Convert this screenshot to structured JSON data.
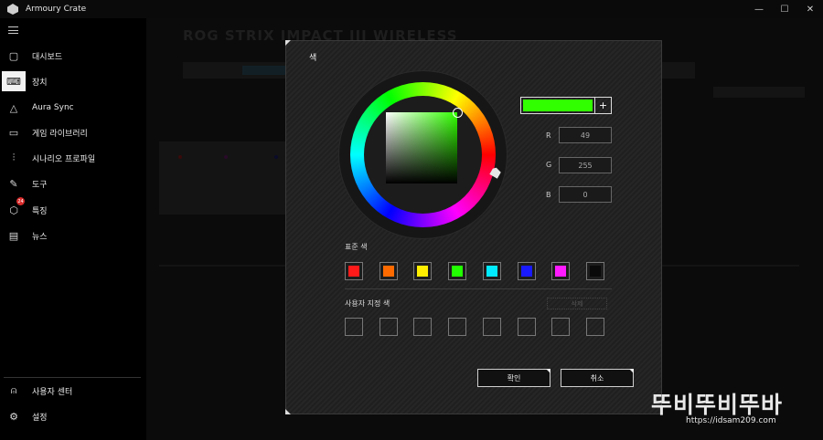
{
  "window": {
    "title": "Armoury Crate",
    "controls": [
      "—",
      "☐",
      "✕"
    ]
  },
  "sidebar": {
    "items": [
      {
        "label": "대시보드",
        "icon": "dashboard-icon",
        "glyph": "▢"
      },
      {
        "label": "장치",
        "icon": "keyboard-icon",
        "glyph": "⌨",
        "active": true
      },
      {
        "label": "Aura Sync",
        "icon": "aura-sync-icon",
        "glyph": "△"
      },
      {
        "label": "게임 라이브러리",
        "icon": "game-library-icon",
        "glyph": "▭"
      },
      {
        "label": "시나리오 프로파일",
        "icon": "scenario-profile-icon",
        "glyph": "⫶"
      },
      {
        "label": "도구",
        "icon": "tools-icon",
        "glyph": "✎"
      },
      {
        "label": "특징",
        "icon": "tag-icon",
        "glyph": "⬡",
        "badge": "24"
      },
      {
        "label": "뉴스",
        "icon": "news-icon",
        "glyph": "▤"
      }
    ],
    "bottom": [
      {
        "label": "사용자 센터",
        "icon": "user-center-icon",
        "glyph": "⍝"
      },
      {
        "label": "설정",
        "icon": "settings-icon",
        "glyph": "⚙"
      }
    ]
  },
  "background": {
    "device_title": "ROG STRIX IMPACT III WIRELESS"
  },
  "dialog": {
    "title": "색",
    "selected_color": "#31ff00",
    "add_label": "+",
    "r_label": "R",
    "g_label": "G",
    "b_label": "B",
    "r_value": "49",
    "g_value": "255",
    "b_value": "0",
    "standard_label": "표준 색",
    "standard_colors": [
      "#ff1a1a",
      "#ff6a00",
      "#ffee00",
      "#22ff00",
      "#00eaff",
      "#1a1aff",
      "#ff1aff",
      "#0a0a0a"
    ],
    "custom_label": "사용자 지정 색",
    "delete_label": "삭제",
    "custom_slots": 8,
    "ok_label": "확인",
    "cancel_label": "취소"
  },
  "watermark": {
    "text": "뚜비뚜비뚜바",
    "url": "https://idsam209.com"
  }
}
